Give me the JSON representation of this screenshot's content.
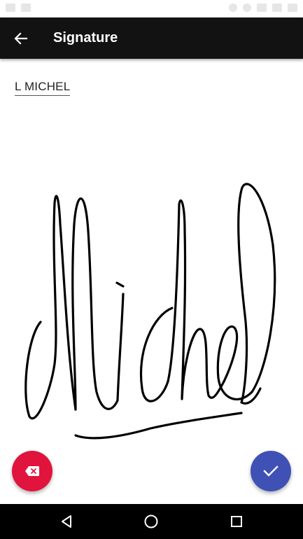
{
  "app_bar": {
    "title": "Signature",
    "back_icon": "arrow-left-icon"
  },
  "signer": {
    "name": "L MICHEL"
  },
  "actions": {
    "clear_icon": "backspace-icon",
    "confirm_icon": "check-icon"
  },
  "nav": {
    "back_icon": "triangle-back-icon",
    "home_icon": "circle-home-icon",
    "recents_icon": "square-recents-icon"
  },
  "colors": {
    "app_bar": "#121212",
    "clear_fab": "#e0143c",
    "confirm_fab": "#3f51b5",
    "ink": "#000000"
  }
}
